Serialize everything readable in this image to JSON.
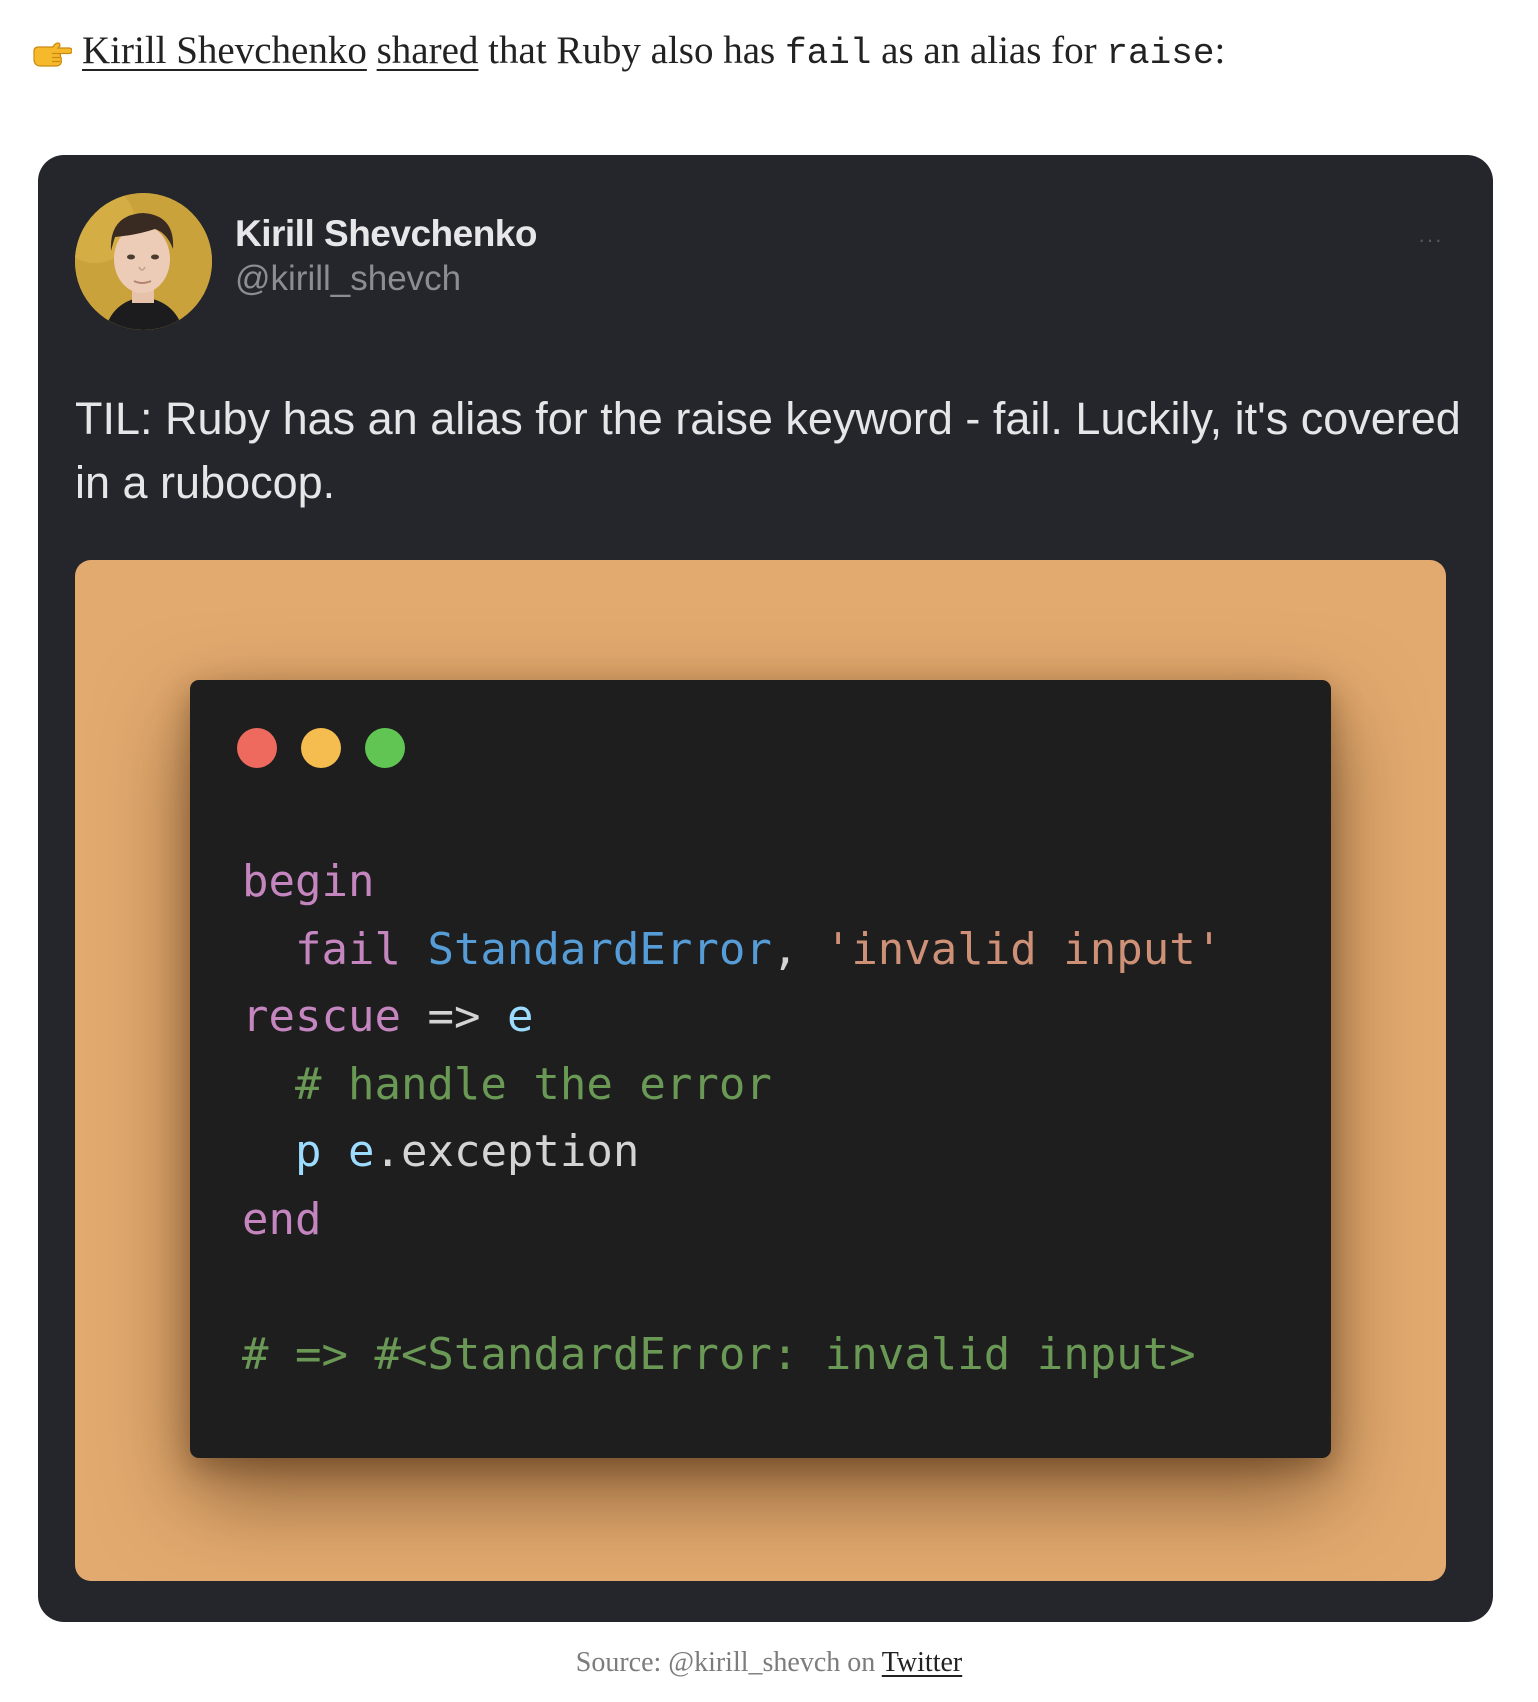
{
  "intro": {
    "emoji": "👉",
    "author_link": "Kirill Shevchenko",
    "shared_link": "shared",
    "text_1": " that Ruby also has ",
    "code_1": "fail",
    "text_2": " as an alias for ",
    "code_2": "raise",
    "text_3": ":"
  },
  "tweet": {
    "author_name": "Kirill Shevchenko",
    "author_handle": "@kirill_shevch",
    "more_label": "···",
    "text": "TIL: Ruby has an alias for the raise keyword - fail. Luckily, it's covered in a rubocop.",
    "media": {
      "background_color": "#e3aa6f",
      "window_dots": [
        "#ee6a5e",
        "#f5bd4f",
        "#61c554"
      ],
      "code": {
        "l1_kw": "begin",
        "l2_indent": "  ",
        "l2_kw": "fail",
        "l2_sp": " ",
        "l2_const": "StandardError",
        "l2_comma": ",",
        "l2_sp2": " ",
        "l2_str": "'invalid input'",
        "l3_kw": "rescue",
        "l3_sp": " ",
        "l3_op": "=>",
        "l3_sp2": " ",
        "l3_var": "e",
        "l4_indent": "  ",
        "l4_comment": "# handle the error",
        "l5_indent": "  ",
        "l5_method": "p",
        "l5_sp": " ",
        "l5_var": "e",
        "l5_rest": ".exception",
        "l6_kw": "end",
        "l8_comment": "# => #<StandardError: invalid input>"
      }
    }
  },
  "caption": {
    "prefix": "Source: @kirill_shevch on ",
    "link": "Twitter"
  }
}
